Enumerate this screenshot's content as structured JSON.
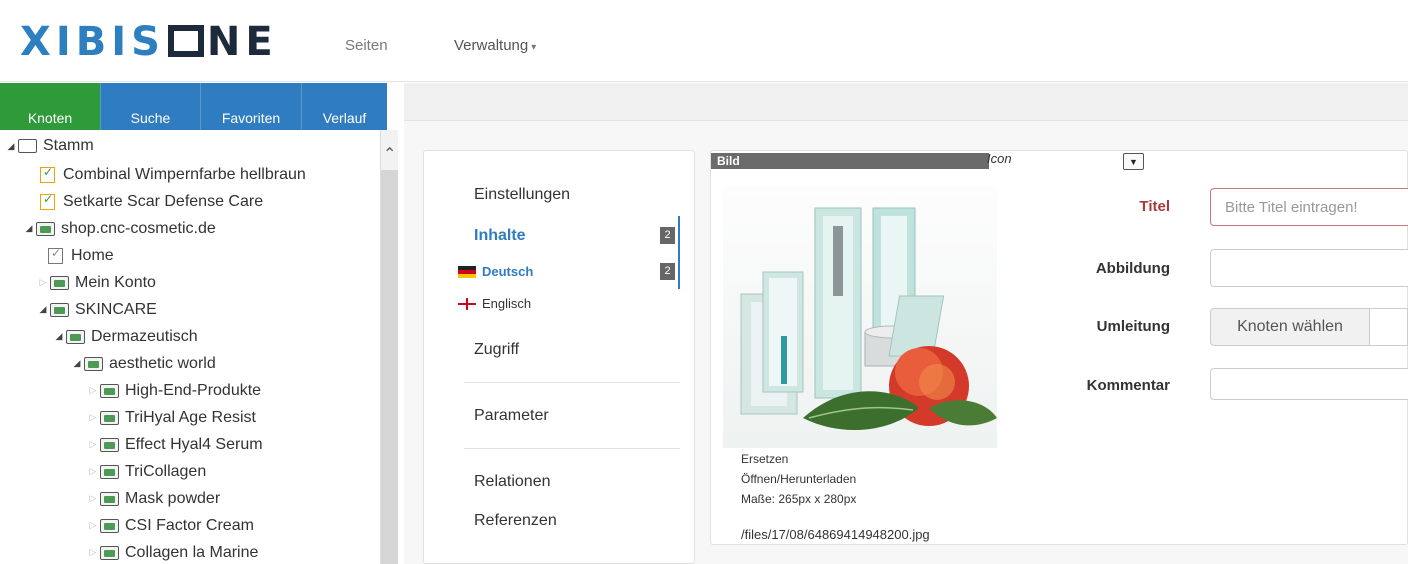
{
  "header": {
    "logo_prefix": "XIBIS",
    "logo_suffix": "NE",
    "nav_seiten": "Seiten",
    "nav_verwaltung": "Verwaltung"
  },
  "left_tabs": [
    {
      "label": "Knoten",
      "active": true
    },
    {
      "label": "Suche"
    },
    {
      "label": "Favoriten"
    },
    {
      "label": "Verlauf"
    }
  ],
  "tree": {
    "stamm": "Stamm",
    "item_combinal": "Combinal Wimpernfarbe hellbraun",
    "item_setkarte": "Setkarte Scar Defense Care",
    "item_shop": "shop.cnc-cosmetic.de",
    "item_home": "Home",
    "item_konto": "Mein Konto",
    "item_skincare": "SKINCARE",
    "item_derma": "Dermazeutisch",
    "item_aesthetic": "aesthetic world",
    "item_highend": "High-End-Produkte",
    "item_trihyal": "TriHyal Age Resist",
    "item_effect": "Effect Hyal4 Serum",
    "item_tricollagen": "TriCollagen",
    "item_mask": "Mask powder",
    "item_csi": "CSI Factor Cream",
    "item_collagen": "Collagen la Marine"
  },
  "menu": {
    "einstellungen": "Einstellungen",
    "inhalte": "Inhalte",
    "inhalte_count": "2",
    "deutsch": "Deutsch",
    "deutsch_count": "2",
    "englisch": "Englisch",
    "zugriff": "Zugriff",
    "parameter": "Parameter",
    "relationen": "Relationen",
    "referenzen": "Referenzen"
  },
  "image_panel": {
    "header": "Bild",
    "icon_label": "Icon",
    "replace": "Ersetzen",
    "open_download": "Öffnen/Herunterladen",
    "dimensions": "Maße: 265px x 280px",
    "path": "/files/17/08/64869414948200.jpg"
  },
  "form": {
    "titel_label": "Titel",
    "titel_placeholder": "Bitte Titel eintragen!",
    "abbildung_label": "Abbildung",
    "umleitung_label": "Umleitung",
    "knoten_button": "Knoten wählen",
    "kommentar_label": "Kommentar"
  },
  "colors": {
    "tab_blue": "#2f7cc1",
    "tab_active_green": "#2e9a3a",
    "titel_red": "#a83a3a"
  }
}
